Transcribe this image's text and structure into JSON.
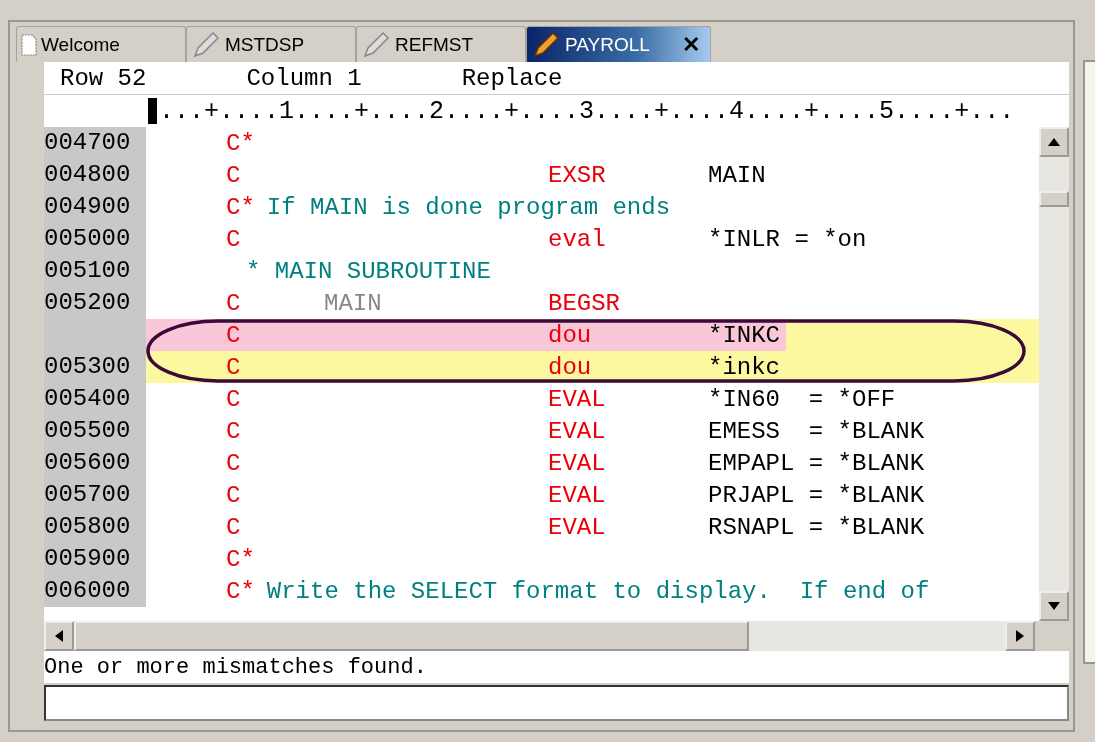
{
  "tabs": [
    {
      "label": "Welcome",
      "kind": "document",
      "selected": false
    },
    {
      "label": "MSTDSP",
      "kind": "pencil",
      "selected": false
    },
    {
      "label": "REFMST",
      "kind": "pencil",
      "selected": false
    },
    {
      "label": "PAYROLL",
      "kind": "pencil",
      "selected": true,
      "close": "✕"
    }
  ],
  "status_line": {
    "row": "Row 52",
    "column": "Column 1",
    "mode": "Replace"
  },
  "ruler": "...+....1....+....2....+....3....+....4....+....5....+...",
  "lines": [
    {
      "seq": "004700",
      "kind": "comment",
      "spec": "C*",
      "highlighted": false,
      "removed": false
    },
    {
      "seq": "004800",
      "kind": "code",
      "spec": "C",
      "opcode": "EXSR",
      "factor2": "MAIN",
      "highlighted": false,
      "removed": false
    },
    {
      "seq": "004900",
      "kind": "comment",
      "spec": "C*",
      "comment": "If MAIN is done program ends",
      "highlighted": false,
      "removed": false
    },
    {
      "seq": "005000",
      "kind": "code",
      "spec": "C",
      "opcode": "eval",
      "factor2": "*INLR = *on",
      "highlighted": false,
      "removed": false
    },
    {
      "seq": "005100",
      "kind": "comment",
      "comment": "* MAIN SUBROUTINE",
      "highlighted": false,
      "removed": false
    },
    {
      "seq": "005200",
      "kind": "code",
      "spec": "C",
      "factor1": "MAIN",
      "opcode": "BEGSR",
      "highlighted": false,
      "removed": false
    },
    {
      "kind": "code",
      "spec": "C",
      "opcode": "dou",
      "factor2": "*INKC",
      "highlighted": true,
      "removed": true
    },
    {
      "seq": "005300",
      "kind": "code",
      "spec": "C",
      "opcode": "dou",
      "factor2": "*inkc",
      "highlighted": true,
      "removed": false
    },
    {
      "seq": "005400",
      "kind": "code",
      "spec": "C",
      "opcode": "EVAL",
      "factor2": "*IN60  = *OFF",
      "highlighted": false,
      "removed": false
    },
    {
      "seq": "005500",
      "kind": "code",
      "spec": "C",
      "opcode": "EVAL",
      "factor2": "EMESS  = *BLANK",
      "highlighted": false,
      "removed": false
    },
    {
      "seq": "005600",
      "kind": "code",
      "spec": "C",
      "opcode": "EVAL",
      "factor2": "EMPAPL = *BLANK",
      "highlighted": false,
      "removed": false
    },
    {
      "seq": "005700",
      "kind": "code",
      "spec": "C",
      "opcode": "EVAL",
      "factor2": "PRJAPL = *BLANK",
      "highlighted": false,
      "removed": false
    },
    {
      "seq": "005800",
      "kind": "code",
      "spec": "C",
      "opcode": "EVAL",
      "factor2": "RSNAPL = *BLANK",
      "highlighted": false,
      "removed": false
    },
    {
      "seq": "005900",
      "kind": "comment",
      "spec": "C*",
      "highlighted": false,
      "removed": false
    },
    {
      "seq": "006000",
      "kind": "comment",
      "spec": "C*",
      "comment": "Write the SELECT format to display.  If end of",
      "highlighted": false,
      "removed": false
    }
  ],
  "message": "One or more mismatches found."
}
